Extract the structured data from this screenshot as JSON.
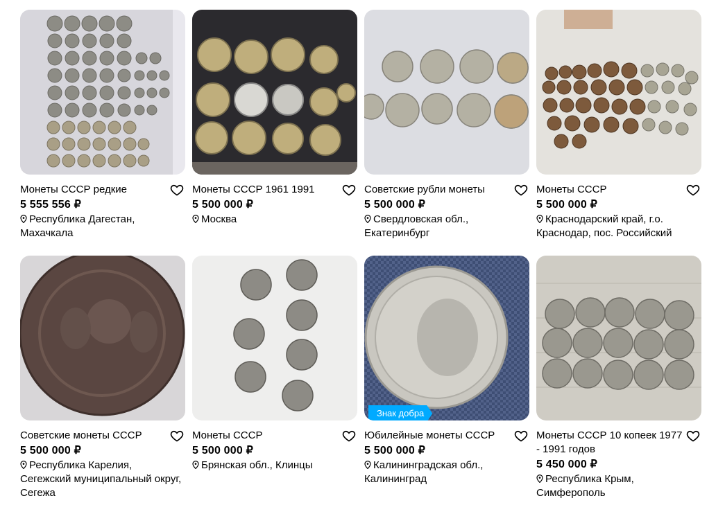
{
  "listings": [
    {
      "title": "Монеты СССР редкие",
      "price": "5 555 556 ₽",
      "location": "Республика Дагестан, Махачкала",
      "badge": null
    },
    {
      "title": "Монеты СССР 1961 1991",
      "price": "5 500 000 ₽",
      "location": "Москва",
      "badge": null
    },
    {
      "title": "Советские рубли монеты",
      "price": "5 500 000 ₽",
      "location": "Свердловская обл., Екатеринбург",
      "badge": null
    },
    {
      "title": "Монеты СССР",
      "price": "5 500 000 ₽",
      "location": "Краснодарский край, г.о. Краснодар, пос. Российский",
      "badge": null
    },
    {
      "title": "Советские монеты СССР",
      "price": "5 500 000 ₽",
      "location": "Республика Карелия, Сегежский муниципальный округ, Сегежа",
      "badge": null
    },
    {
      "title": "Монеты СССР",
      "price": "5 500 000 ₽",
      "location": "Брянская обл., Клинцы",
      "badge": null
    },
    {
      "title": "Юбилейные монеты СССР",
      "price": "5 500 000 ₽",
      "location": "Калининградская обл., Калининград",
      "badge": "Знак добра"
    },
    {
      "title": "Монеты СССР 10 копеек 1977 - 1991 годов",
      "price": "5 450 000 ₽",
      "location": "Республика Крым, Симферополь",
      "badge": null
    }
  ],
  "colors": {
    "badge": "#00aaff",
    "text": "#000000",
    "background": "#ffffff"
  },
  "icons": {
    "favorite": "heart-outline-icon",
    "location": "location-pin-icon"
  }
}
